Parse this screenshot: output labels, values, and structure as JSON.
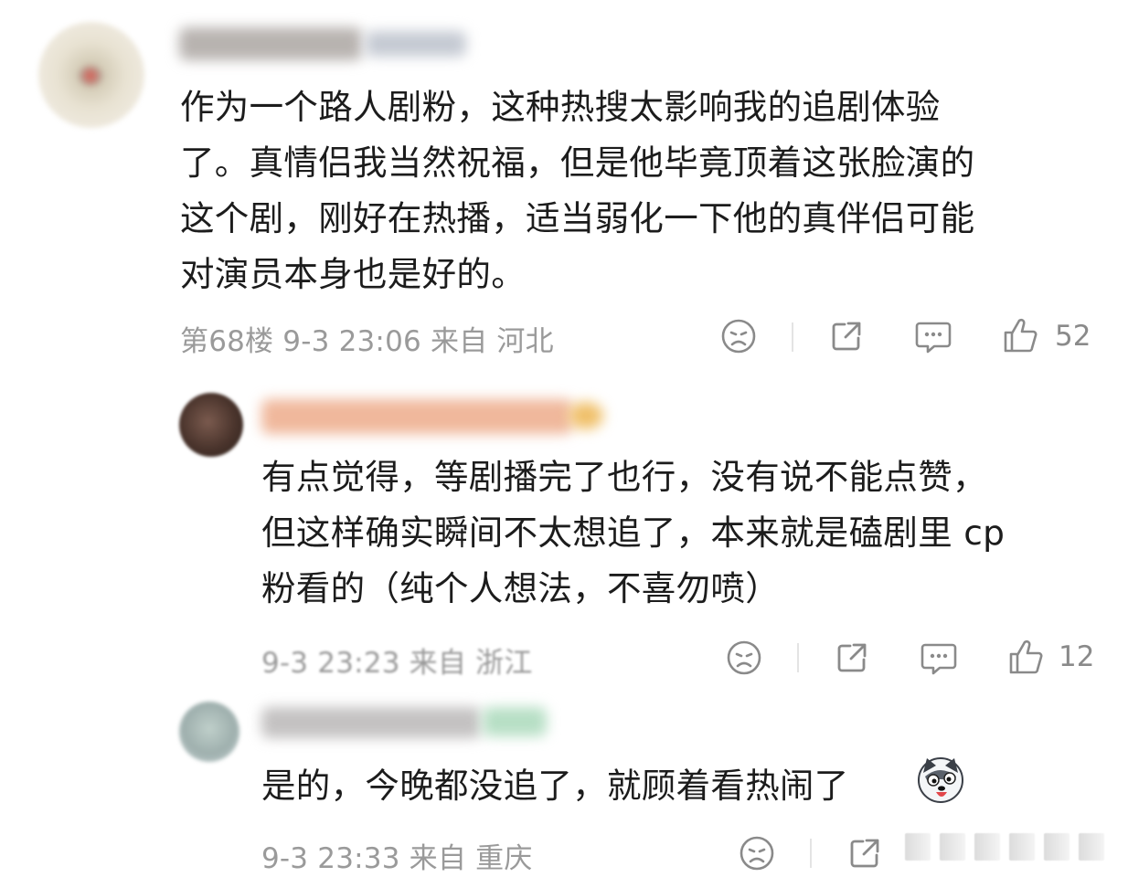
{
  "comments": [
    {
      "lines": [
        "作为一个路人剧粉，这种热搜太影响我的追剧体验",
        "了。真情侣我当然祝福，但是他毕竟顶着这张脸演的",
        "这个剧，刚好在热播，适当弱化一下他的真伴侣可能",
        "对演员本身也是好的。"
      ],
      "meta": "第68楼 9-3 23:06 来自 河北",
      "likes": "52"
    },
    {
      "lines": [
        "有点觉得，等剧播完了也行，没有说不能点赞，",
        "但这样确实瞬间不太想追了，本来就是磕剧里 cp",
        "粉看的（纯个人想法，不喜勿喷）"
      ],
      "meta": "9-3 23:23 来自 浙江",
      "likes": "12"
    },
    {
      "lines": [
        "是的，今晚都没追了，就顾着看热闹了"
      ],
      "meta": "9-3 23:33 来自 重庆"
    }
  ],
  "icons": {
    "dislike": "sad-face-icon",
    "share": "share-icon",
    "reply": "comment-bubble-icon",
    "like": "thumbs-up-icon",
    "emoji": "husky-dog-emoji-icon"
  },
  "colors": {
    "text": "#1c1c1c",
    "meta": "#9a9a9a",
    "icon": "#8a8a8a"
  }
}
